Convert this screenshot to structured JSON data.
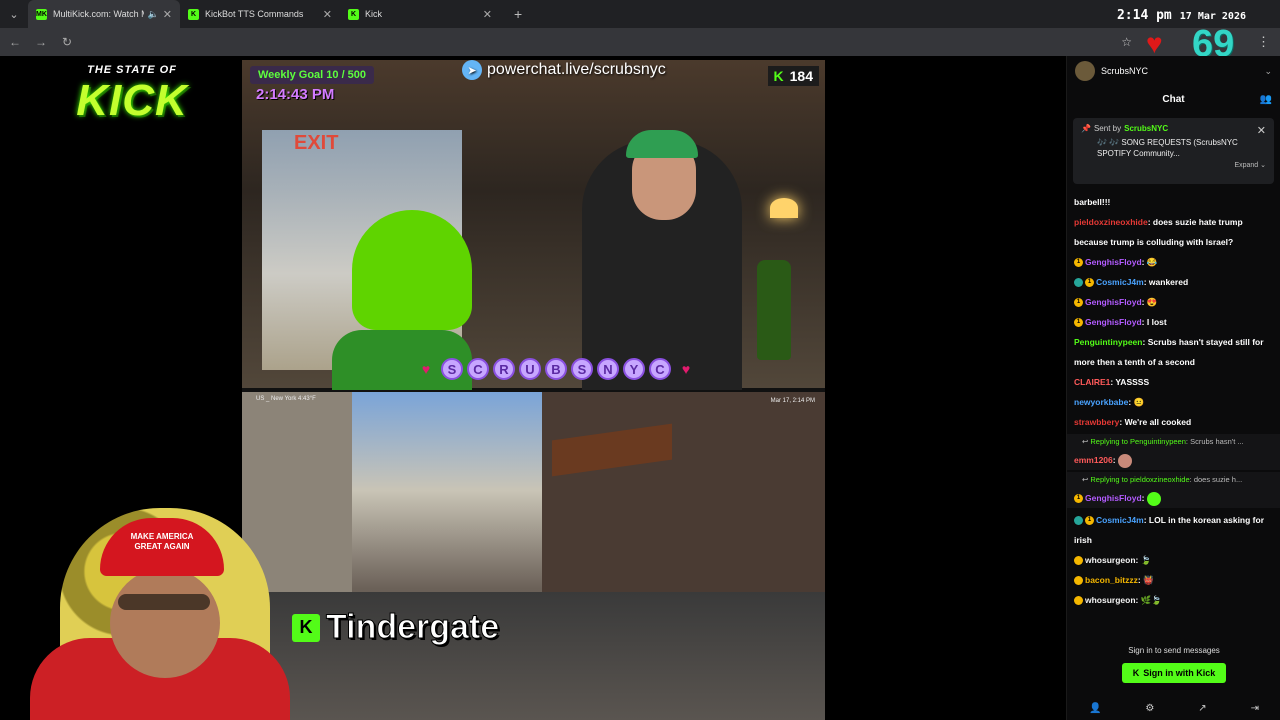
{
  "browser": {
    "tabs": [
      {
        "label": "MultiKick.com: Watch Multi",
        "favicon": "MK",
        "active": true,
        "muted": true
      },
      {
        "label": "KickBot TTS Commands",
        "favicon": "K",
        "active": false
      },
      {
        "label": "Kick",
        "favicon": "K",
        "active": false
      }
    ],
    "clock_time": "2:14 pm",
    "clock_date": "17 Mar 2026"
  },
  "overlay": {
    "logo_top": "THE STATE OF",
    "logo_main": "KICK",
    "counter": "69"
  },
  "stream": {
    "goal": "Weekly Goal 10 / 500",
    "clock": "2:14:43 PM",
    "powerchat": "powerchat.live/scrubsnyc",
    "viewers": "184",
    "name_letters": [
      "S",
      "C",
      "R",
      "U",
      "B",
      "S",
      "N",
      "Y",
      "C"
    ],
    "exit_sign": "EXIT",
    "location": "US _ New York 4:43°F",
    "timestamp": "Mar 17, 2:14 PM",
    "caption": "Tindergate",
    "hat_text_line1": "MAKE AMERICA",
    "hat_text_line2": "GREAT AGAIN"
  },
  "chat": {
    "channel": "ScrubsNYC",
    "title": "Chat",
    "pinned": {
      "sent_by_label": "Sent by",
      "sender": "ScrubsNYC",
      "message": "🎶 🎶 SONG REQUESTS (ScrubsNYC SPOTIFY Community...",
      "expand": "Expand ⌄"
    },
    "messages": [
      {
        "user": "",
        "text": "barbell!!!"
      },
      {
        "user": "pieldoxzineoxhide",
        "color": "#e53935",
        "text": "does suzie hate trump because trump is colluding with Israel?"
      },
      {
        "user": "GenghisFloyd",
        "color": "#b35bff",
        "text": "😂"
      },
      {
        "user": "CosmicJ4m",
        "color": "#4aa3ff",
        "text": "wankered"
      },
      {
        "user": "GenghisFloyd",
        "color": "#b35bff",
        "text": "😍"
      },
      {
        "user": "GenghisFloyd",
        "color": "#b35bff",
        "text": "I lost"
      },
      {
        "user": "Penguintinypeen",
        "color": "#53fc18",
        "text": "Scrubs hasn't stayed still for more then a tenth of a second"
      },
      {
        "user": "CLAIRE1",
        "color": "#ff5a5a",
        "text": "YASSSS"
      },
      {
        "user": "newyorkbabe",
        "color": "#4aa3ff",
        "text": "😐"
      },
      {
        "user": "strawbbery",
        "color": "#e53935",
        "text": "We're all cooked"
      }
    ],
    "replies": [
      {
        "replying_label": "Replying to",
        "to": "Penguintinypeen",
        "snippet": "Scrubs hasn't ...",
        "user": "emm1206",
        "color": "#ff5a5a",
        "text": ""
      },
      {
        "replying_label": "Replying to",
        "to": "pieldoxzineoxhide",
        "snippet": "does suzie h...",
        "user": "GenghisFloyd",
        "color": "#b35bff",
        "text": ""
      }
    ],
    "messages2": [
      {
        "user": "CosmicJ4m",
        "color": "#4aa3ff",
        "text": "LOL in the korean asking for irish"
      },
      {
        "user": "whosurgeon",
        "color": "#f5f5f5",
        "text": "🍃"
      },
      {
        "user": "bacon_bitzzz",
        "color": "#f5b700",
        "text": "👹"
      },
      {
        "user": "whosurgeon",
        "color": "#f5f5f5",
        "text": "🌿🍃"
      }
    ],
    "signin_prompt": "Sign in to send messages",
    "signin_button": "Sign in with Kick"
  }
}
